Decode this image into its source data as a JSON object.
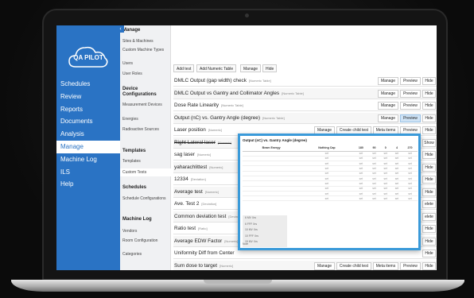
{
  "app": {
    "logo_text": "QA PILOT",
    "collapse_glyph": "‹"
  },
  "nav": {
    "items": [
      {
        "label": "Schedules",
        "active": false
      },
      {
        "label": "Review",
        "active": false
      },
      {
        "label": "Reports",
        "active": false
      },
      {
        "label": "Documents",
        "active": false
      },
      {
        "label": "Analysis",
        "active": false
      },
      {
        "label": "Manage",
        "active": true
      },
      {
        "label": "Machine Log",
        "active": false
      },
      {
        "label": "ILS",
        "active": false
      },
      {
        "label": "Help",
        "active": false
      }
    ]
  },
  "submenu": {
    "sections": [
      {
        "title": "Manage",
        "items": [
          "Sites & Machines",
          "Custom Machine Types",
          "Users",
          "User Roles"
        ]
      },
      {
        "title": "Device Configurations",
        "items": [
          "Measurement Devices",
          "Energies",
          "Radioactive Sources"
        ]
      },
      {
        "title": "Templates",
        "items": [
          "Templates",
          "Custom Tests"
        ]
      },
      {
        "title": "Schedules",
        "items": [
          "Schedule Configurations"
        ]
      },
      {
        "title": "Machine Log",
        "items": [
          "Vendors",
          "Room Configuration",
          "Categories"
        ]
      }
    ],
    "active_item": "Custom Tests"
  },
  "toolbar": {
    "actions": [
      "Add test",
      "Add Numeric Table",
      "Manage",
      "Hide"
    ]
  },
  "tests": [
    {
      "name": "DMLC Output (gap width) check",
      "type": "[Numeric Table]",
      "buttons": [
        "Manage",
        "Preview",
        "Hide"
      ]
    },
    {
      "name": "DMLC Output vs Gantry and Collimator Angles",
      "type": "[Numeric Table]",
      "buttons": [
        "Manage",
        "Preview",
        "Hide"
      ]
    },
    {
      "name": "Dose Rate Linearity",
      "type": "[Numeric Table]",
      "buttons": [
        "Manage",
        "Preview",
        "Hide"
      ]
    },
    {
      "name": "Output (nC) vs. Gantry Angle (degree)",
      "type": "[Numeric Table]",
      "buttons": [
        "Manage",
        "Preview",
        "Hide"
      ],
      "highlight": "Preview"
    },
    {
      "name": "Laser position",
      "type": "[Numeric]",
      "buttons": [
        "Manage",
        "Create child test",
        "Meta items",
        "Preview",
        "Hide"
      ]
    },
    {
      "name": "Right Lateral laser",
      "type": "[Numeric]",
      "buttons": [
        "Show"
      ],
      "strike": true
    },
    {
      "name": "sag laser",
      "type": "[Numeric]",
      "buttons": [
        "Hide"
      ]
    },
    {
      "name": "yaharachlittest",
      "type": "[Numeric]",
      "buttons": [
        "Hide"
      ]
    },
    {
      "name": "12334",
      "type": "[Deviation]",
      "buttons": [
        "Hide"
      ]
    },
    {
      "name": "Average test",
      "type": "[Numeric]",
      "buttons": [
        "Hide"
      ]
    },
    {
      "name": "Ave. Test 2",
      "type": "[Deviation]",
      "buttons": [
        "elete"
      ]
    },
    {
      "name": "Common deviation test",
      "type": "[Deviation]",
      "buttons": [
        "elete"
      ]
    },
    {
      "name": "Ratio test",
      "type": "[Ratio]",
      "buttons": [
        "Hide"
      ]
    },
    {
      "name": "Average EDW Factor",
      "type": "[Numeric]",
      "buttons": [
        "Hide"
      ]
    },
    {
      "name": "Uniformity Diff from Center",
      "type": "",
      "buttons": [
        "Hide"
      ]
    },
    {
      "name": "Sum dose to target",
      "type": "[Numeric]",
      "buttons": [
        "Manage",
        "Create child test",
        "Meta items",
        "Preview",
        "Hide"
      ]
    }
  ],
  "preview": {
    "title": "Output (nC) vs. Gantry Angle (degree)",
    "columns": [
      "Beam Energy",
      "Nothing Cap",
      "180",
      "90",
      "0",
      "4",
      "270"
    ],
    "row_count": 10,
    "cell_text": "set",
    "energies": [
      "6 MV Xrs",
      "6 FFF Xrs",
      "10 MV Xrs",
      "10 FFF Xrs",
      "15 MV Xrs"
    ],
    "footer": "Note"
  },
  "colors": {
    "nav_blue": "#2a73c4",
    "preview_border": "#3a9ad9",
    "preview_button": "#cfe3f5"
  }
}
